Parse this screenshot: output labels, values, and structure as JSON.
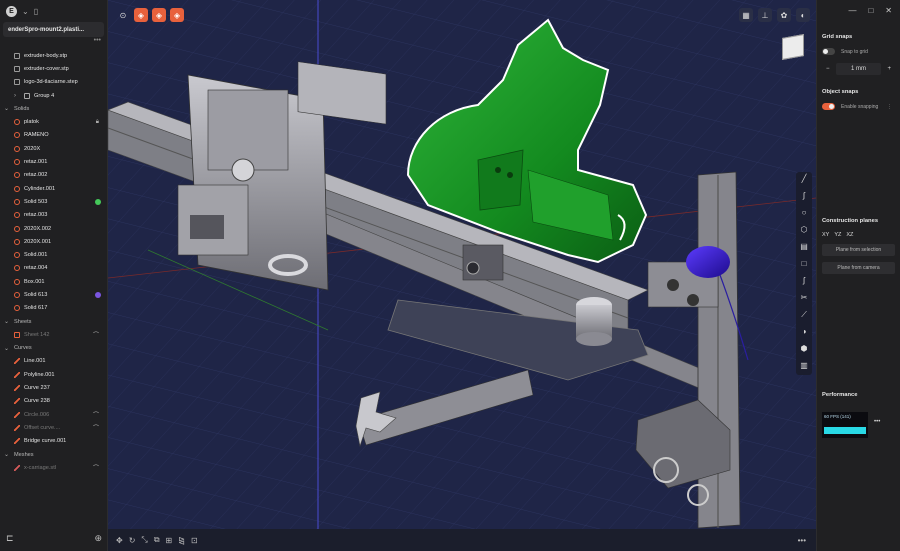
{
  "sidebar": {
    "logo": "E",
    "file_tab": "enderSpro-mount2.plasti...",
    "tree": [
      {
        "type": "file",
        "label": "extruder-body.stp",
        "cls": ""
      },
      {
        "type": "file",
        "label": "extruder-cover.stp",
        "cls": ""
      },
      {
        "type": "file",
        "label": "logo-3d-tlaciarne.step",
        "cls": ""
      },
      {
        "type": "folder",
        "label": "Group 4",
        "cls": "",
        "chev": "›"
      },
      {
        "type": "hdr",
        "label": "Solids",
        "cls": "hdr",
        "chev": "⌄"
      },
      {
        "type": "solid",
        "label": "platok",
        "cls": "",
        "right": "lock-icon"
      },
      {
        "type": "solid",
        "label": "RAMENO",
        "cls": ""
      },
      {
        "type": "solid",
        "label": "2020X",
        "cls": ""
      },
      {
        "type": "solid",
        "label": "retaz.001",
        "cls": ""
      },
      {
        "type": "solid",
        "label": "retaz.002",
        "cls": ""
      },
      {
        "type": "solid",
        "label": "Cylinder.001",
        "cls": ""
      },
      {
        "type": "solid",
        "label": "Solid 503",
        "cls": "",
        "dot": "#45c95a"
      },
      {
        "type": "solid",
        "label": "retaz.003",
        "cls": ""
      },
      {
        "type": "solid",
        "label": "2020X.002",
        "cls": ""
      },
      {
        "type": "solid",
        "label": "2020X.001",
        "cls": ""
      },
      {
        "type": "solid",
        "label": "Solid.001",
        "cls": ""
      },
      {
        "type": "solid",
        "label": "retaz.004",
        "cls": ""
      },
      {
        "type": "solid",
        "label": "Box.001",
        "cls": ""
      },
      {
        "type": "solid",
        "label": "Solid 613",
        "cls": "",
        "dot": "#7a55e0"
      },
      {
        "type": "solid",
        "label": "Solid 617",
        "cls": ""
      },
      {
        "type": "hdr",
        "label": "Sheets",
        "cls": "hdr",
        "chev": "⌄"
      },
      {
        "type": "sheet",
        "label": "Sheet 142",
        "cls": "dim",
        "right": "hidden-icon"
      },
      {
        "type": "hdr",
        "label": "Curves",
        "cls": "hdr",
        "chev": "⌄"
      },
      {
        "type": "curve",
        "label": "Line.001",
        "cls": ""
      },
      {
        "type": "curve",
        "label": "Polyline.001",
        "cls": ""
      },
      {
        "type": "curve",
        "label": "Curve 237",
        "cls": ""
      },
      {
        "type": "curve",
        "label": "Curve 238",
        "cls": ""
      },
      {
        "type": "curve",
        "label": "Circle.006",
        "cls": "dim",
        "right": "hidden-icon"
      },
      {
        "type": "curve",
        "label": "Offset curve....",
        "cls": "dim",
        "right": "hidden-icon"
      },
      {
        "type": "curve",
        "label": "Bridge curve.001",
        "cls": ""
      },
      {
        "type": "hdr",
        "label": "Meshes",
        "cls": "hdr",
        "chev": "⌄"
      },
      {
        "type": "mesh",
        "label": "x-carriage.stl",
        "cls": "dim",
        "right": "hidden-icon"
      }
    ]
  },
  "rpanel": {
    "grid_snaps": "Grid snaps",
    "snap_to_grid": "Snap to grid",
    "grid_minus": "−",
    "grid_value": "1 mm",
    "grid_plus": "+",
    "object_snaps": "Object snaps",
    "enable_snapping": "Enable snapping",
    "construction_planes": "Construction planes",
    "plane_xy": "XY",
    "plane_yz": "YZ",
    "plane_xz": "XZ",
    "plane_from_selection": "Plane from selection",
    "plane_from_camera": "Plane from camera",
    "performance": "Performance",
    "fps": "60 FPS (141)",
    "more": "•••"
  },
  "window": {
    "minimize": "—",
    "maximize": "□",
    "close": "✕"
  }
}
